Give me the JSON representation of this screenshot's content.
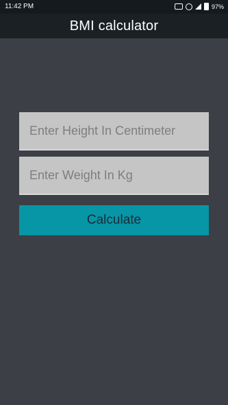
{
  "status_bar": {
    "time": "11:42 PM",
    "battery_percent": "97%",
    "icons": [
      "message-icon",
      "alarm-icon",
      "signal-icon",
      "battery-icon"
    ]
  },
  "app_bar": {
    "title": "BMI calculator"
  },
  "form": {
    "height_placeholder": "Enter Height In Centimeter",
    "height_value": "",
    "weight_placeholder": "Enter Weight In Kg",
    "weight_value": "",
    "calculate_label": "Calculate"
  },
  "colors": {
    "background": "#3c3f45",
    "app_bar": "#1b2025",
    "field_background": "#c5c5c5",
    "accent": "#0796a6"
  }
}
